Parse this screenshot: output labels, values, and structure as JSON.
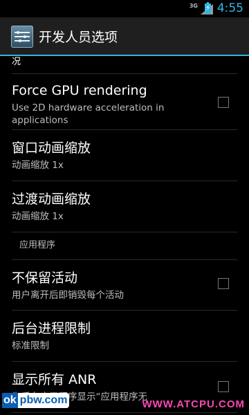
{
  "status_bar": {
    "network": "3G",
    "time": "4:55",
    "accent": "#33b5e5"
  },
  "action_bar": {
    "title": "开发人员选项",
    "icon": "developer-settings-icon"
  },
  "settings": {
    "partial_top": "况",
    "items": [
      {
        "title": "Force GPU rendering",
        "summary": "Use 2D hardware acceleration in applications",
        "checked": false
      },
      {
        "title": "窗口动画缩放",
        "summary": "动画缩放 1x"
      },
      {
        "title": "过渡动画缩放",
        "summary": "动画缩放 1x"
      },
      {
        "title": "不保留活动",
        "summary": "用户离开后即销毁每个活动",
        "checked": false
      },
      {
        "title": "后台进程限制",
        "summary": "标准限制"
      },
      {
        "title": "显示所有 ANR",
        "summary": "为后台应用程序显示“应用程序无",
        "checked": false
      }
    ],
    "section_apps": "应用程序"
  },
  "watermarks": {
    "left_ok": "ok",
    "left_rest": "pbw.com",
    "right": "WWW.ATCPU.COM"
  }
}
